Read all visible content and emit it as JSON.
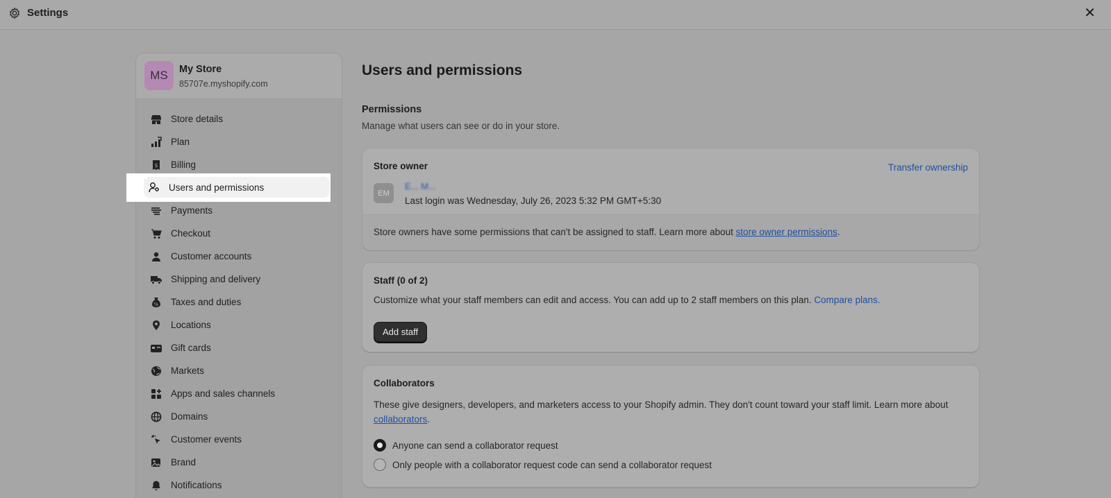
{
  "window": {
    "title": "Settings",
    "close_label": "✕"
  },
  "store": {
    "initials": "MS",
    "name": "My Store",
    "domain": "85707e.myshopify.com"
  },
  "sidebar": {
    "items": [
      {
        "label": "Store details",
        "icon": "store-icon"
      },
      {
        "label": "Plan",
        "icon": "plan-icon"
      },
      {
        "label": "Billing",
        "icon": "billing-icon"
      },
      {
        "label": "Users and permissions",
        "icon": "users-icon",
        "selected": true
      },
      {
        "label": "Payments",
        "icon": "payments-icon"
      },
      {
        "label": "Checkout",
        "icon": "cart-icon"
      },
      {
        "label": "Customer accounts",
        "icon": "person-icon"
      },
      {
        "label": "Shipping and delivery",
        "icon": "truck-icon"
      },
      {
        "label": "Taxes and duties",
        "icon": "taxes-icon"
      },
      {
        "label": "Locations",
        "icon": "location-icon"
      },
      {
        "label": "Gift cards",
        "icon": "gift-card-icon"
      },
      {
        "label": "Markets",
        "icon": "globe-icon"
      },
      {
        "label": "Apps and sales channels",
        "icon": "apps-icon"
      },
      {
        "label": "Domains",
        "icon": "domains-icon"
      },
      {
        "label": "Customer events",
        "icon": "cursor-icon"
      },
      {
        "label": "Brand",
        "icon": "brand-icon"
      },
      {
        "label": "Notifications",
        "icon": "bell-icon"
      }
    ]
  },
  "main": {
    "title": "Users and permissions",
    "permissions": {
      "title": "Permissions",
      "subtitle": "Manage what users can see or do in your store."
    },
    "owner_card": {
      "title": "Store owner",
      "transfer_label": "Transfer ownership",
      "owner_initials": "EM",
      "owner_name": "E... M...",
      "last_login": "Last login was Wednesday, July 26, 2023 5:32 PM GMT+5:30",
      "note_prefix": "Store owners have some permissions that can't be assigned to staff. Learn more about ",
      "note_link": "store owner permissions",
      "note_suffix": "."
    },
    "staff_card": {
      "title": "Staff (0 of 2)",
      "description": "Customize what your staff members can edit and access. You can add up to 2 staff members on this plan. ",
      "compare_link": "Compare plans.",
      "add_button": "Add staff"
    },
    "collab_card": {
      "title": "Collaborators",
      "description": "These give designers, developers, and marketers access to your Shopify admin. They don't count toward your staff limit. Learn more about ",
      "link": "collaborators",
      "suffix": ".",
      "options": [
        {
          "label": "Anyone can send a collaborator request",
          "checked": true
        },
        {
          "label": "Only people with a collaborator request code can send a collaborator request",
          "checked": false
        }
      ]
    }
  }
}
